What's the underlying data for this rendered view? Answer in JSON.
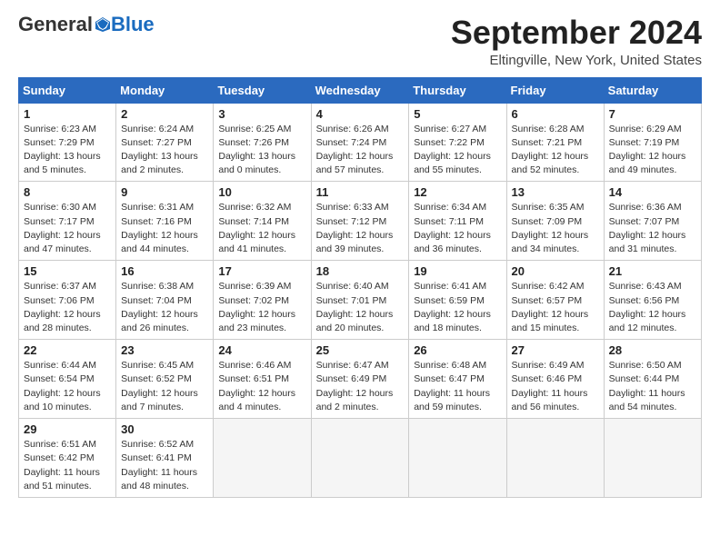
{
  "header": {
    "logo_general": "General",
    "logo_blue": "Blue",
    "month_title": "September 2024",
    "location": "Eltingville, New York, United States"
  },
  "days_of_week": [
    "Sunday",
    "Monday",
    "Tuesday",
    "Wednesday",
    "Thursday",
    "Friday",
    "Saturday"
  ],
  "weeks": [
    [
      {
        "day": "1",
        "info": "Sunrise: 6:23 AM\nSunset: 7:29 PM\nDaylight: 13 hours\nand 5 minutes."
      },
      {
        "day": "2",
        "info": "Sunrise: 6:24 AM\nSunset: 7:27 PM\nDaylight: 13 hours\nand 2 minutes."
      },
      {
        "day": "3",
        "info": "Sunrise: 6:25 AM\nSunset: 7:26 PM\nDaylight: 13 hours\nand 0 minutes."
      },
      {
        "day": "4",
        "info": "Sunrise: 6:26 AM\nSunset: 7:24 PM\nDaylight: 12 hours\nand 57 minutes."
      },
      {
        "day": "5",
        "info": "Sunrise: 6:27 AM\nSunset: 7:22 PM\nDaylight: 12 hours\nand 55 minutes."
      },
      {
        "day": "6",
        "info": "Sunrise: 6:28 AM\nSunset: 7:21 PM\nDaylight: 12 hours\nand 52 minutes."
      },
      {
        "day": "7",
        "info": "Sunrise: 6:29 AM\nSunset: 7:19 PM\nDaylight: 12 hours\nand 49 minutes."
      }
    ],
    [
      {
        "day": "8",
        "info": "Sunrise: 6:30 AM\nSunset: 7:17 PM\nDaylight: 12 hours\nand 47 minutes."
      },
      {
        "day": "9",
        "info": "Sunrise: 6:31 AM\nSunset: 7:16 PM\nDaylight: 12 hours\nand 44 minutes."
      },
      {
        "day": "10",
        "info": "Sunrise: 6:32 AM\nSunset: 7:14 PM\nDaylight: 12 hours\nand 41 minutes."
      },
      {
        "day": "11",
        "info": "Sunrise: 6:33 AM\nSunset: 7:12 PM\nDaylight: 12 hours\nand 39 minutes."
      },
      {
        "day": "12",
        "info": "Sunrise: 6:34 AM\nSunset: 7:11 PM\nDaylight: 12 hours\nand 36 minutes."
      },
      {
        "day": "13",
        "info": "Sunrise: 6:35 AM\nSunset: 7:09 PM\nDaylight: 12 hours\nand 34 minutes."
      },
      {
        "day": "14",
        "info": "Sunrise: 6:36 AM\nSunset: 7:07 PM\nDaylight: 12 hours\nand 31 minutes."
      }
    ],
    [
      {
        "day": "15",
        "info": "Sunrise: 6:37 AM\nSunset: 7:06 PM\nDaylight: 12 hours\nand 28 minutes."
      },
      {
        "day": "16",
        "info": "Sunrise: 6:38 AM\nSunset: 7:04 PM\nDaylight: 12 hours\nand 26 minutes."
      },
      {
        "day": "17",
        "info": "Sunrise: 6:39 AM\nSunset: 7:02 PM\nDaylight: 12 hours\nand 23 minutes."
      },
      {
        "day": "18",
        "info": "Sunrise: 6:40 AM\nSunset: 7:01 PM\nDaylight: 12 hours\nand 20 minutes."
      },
      {
        "day": "19",
        "info": "Sunrise: 6:41 AM\nSunset: 6:59 PM\nDaylight: 12 hours\nand 18 minutes."
      },
      {
        "day": "20",
        "info": "Sunrise: 6:42 AM\nSunset: 6:57 PM\nDaylight: 12 hours\nand 15 minutes."
      },
      {
        "day": "21",
        "info": "Sunrise: 6:43 AM\nSunset: 6:56 PM\nDaylight: 12 hours\nand 12 minutes."
      }
    ],
    [
      {
        "day": "22",
        "info": "Sunrise: 6:44 AM\nSunset: 6:54 PM\nDaylight: 12 hours\nand 10 minutes."
      },
      {
        "day": "23",
        "info": "Sunrise: 6:45 AM\nSunset: 6:52 PM\nDaylight: 12 hours\nand 7 minutes."
      },
      {
        "day": "24",
        "info": "Sunrise: 6:46 AM\nSunset: 6:51 PM\nDaylight: 12 hours\nand 4 minutes."
      },
      {
        "day": "25",
        "info": "Sunrise: 6:47 AM\nSunset: 6:49 PM\nDaylight: 12 hours\nand 2 minutes."
      },
      {
        "day": "26",
        "info": "Sunrise: 6:48 AM\nSunset: 6:47 PM\nDaylight: 11 hours\nand 59 minutes."
      },
      {
        "day": "27",
        "info": "Sunrise: 6:49 AM\nSunset: 6:46 PM\nDaylight: 11 hours\nand 56 minutes."
      },
      {
        "day": "28",
        "info": "Sunrise: 6:50 AM\nSunset: 6:44 PM\nDaylight: 11 hours\nand 54 minutes."
      }
    ],
    [
      {
        "day": "29",
        "info": "Sunrise: 6:51 AM\nSunset: 6:42 PM\nDaylight: 11 hours\nand 51 minutes."
      },
      {
        "day": "30",
        "info": "Sunrise: 6:52 AM\nSunset: 6:41 PM\nDaylight: 11 hours\nand 48 minutes."
      },
      {
        "day": "",
        "info": ""
      },
      {
        "day": "",
        "info": ""
      },
      {
        "day": "",
        "info": ""
      },
      {
        "day": "",
        "info": ""
      },
      {
        "day": "",
        "info": ""
      }
    ]
  ]
}
